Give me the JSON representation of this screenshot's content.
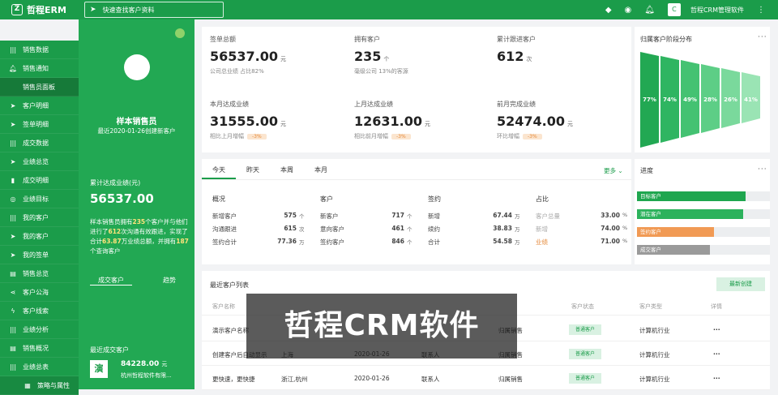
{
  "app": {
    "title": "哲程ERM",
    "logo_mark": "Z"
  },
  "search": {
    "placeholder": "快速查找客户资料"
  },
  "topbar": {
    "company": "哲程CRM管理软件",
    "avatar": "C"
  },
  "sidebar": {
    "items": [
      {
        "label": "销售数据",
        "icon": "bar-icon",
        "sub": false
      },
      {
        "label": "销售通知",
        "icon": "bell-icon",
        "sub": false
      },
      {
        "label": "销售员面板",
        "icon": "",
        "sub": true
      },
      {
        "label": "客户明细",
        "icon": "send-icon",
        "sub": false
      },
      {
        "label": "签单明细",
        "icon": "send-icon",
        "sub": false
      },
      {
        "label": "成交数据",
        "icon": "bar-icon",
        "sub": false
      },
      {
        "label": "业绩总览",
        "icon": "send-icon",
        "sub": false
      },
      {
        "label": "成交明细",
        "icon": "signal-icon",
        "sub": false
      },
      {
        "label": "业绩目标",
        "icon": "target-icon",
        "sub": false
      },
      {
        "label": "我的客户",
        "icon": "bar-icon",
        "sub": false
      },
      {
        "label": "我的客户",
        "icon": "send-icon",
        "sub": false
      },
      {
        "label": "我的签单",
        "icon": "send-icon",
        "sub": false
      },
      {
        "label": "销售总览",
        "icon": "doc-icon",
        "sub": false
      },
      {
        "label": "客户公海",
        "icon": "share-icon",
        "sub": false
      },
      {
        "label": "客户线索",
        "icon": "bolt-icon",
        "sub": false
      },
      {
        "label": "业绩分析",
        "icon": "bar-icon",
        "sub": false
      },
      {
        "label": "销售概况",
        "icon": "doc-icon",
        "sub": false
      },
      {
        "label": "业绩总表",
        "icon": "bar-icon",
        "sub": false
      },
      {
        "label": "策略与属性",
        "icon": "grid-icon",
        "sub": true
      }
    ]
  },
  "profile": {
    "name": "样本销售员",
    "date": "最近2020-01-26创建新客户",
    "total_label": "累计达成业绩(元)",
    "total_value": "56537.00",
    "desc_prefix": "样本销售员拥有",
    "desc_customers": "235",
    "desc_mid1": "个客户并与他们进行了",
    "desc_visits": "612",
    "desc_mid2": "次沟通有效跟进，实现了合计",
    "desc_amount": "63.87",
    "desc_mid3": "万业绩总额，并拥有",
    "desc_repeat": "187",
    "desc_suffix": "个查询客户",
    "tabs": [
      "成交客户",
      "趋势"
    ],
    "recent_label": "最近成交客户",
    "recent_icon": "演",
    "recent_amount": "84228.00",
    "recent_unit": "元",
    "recent_name": "杭州哲程软件有限..."
  },
  "stats": [
    {
      "title": "签单总额",
      "value": "56537.00",
      "unit": "元",
      "sub": "公司总业绩  占比82%",
      "badge": ""
    },
    {
      "title": "拥有客户",
      "value": "235",
      "unit": "个",
      "sub": "毫级公司  13%的客源",
      "badge": ""
    },
    {
      "title": "累计跟进客户",
      "value": "612",
      "unit": "次",
      "sub": "",
      "badge": ""
    },
    {
      "title": "本月达成业绩",
      "value": "31555.00",
      "unit": "元",
      "sub": "相比上月增幅",
      "badge": "-3%"
    },
    {
      "title": "上月达成业绩",
      "value": "12631.00",
      "unit": "元",
      "sub": "相比前月增幅",
      "badge": "-3%"
    },
    {
      "title": "前月完成业绩",
      "value": "52474.00",
      "unit": "元",
      "sub": "环比增幅",
      "badge": "-3%"
    }
  ],
  "funnel": {
    "title": "归属客户阶段分布",
    "more": "···",
    "values": [
      77,
      74,
      49,
      28,
      26,
      41
    ],
    "labels": [
      "77%",
      "74%",
      "49%",
      "28%",
      "26%",
      "41%"
    ],
    "colors": [
      "#22a853",
      "#2fb561",
      "#44c272",
      "#5dce86",
      "#7ad99c",
      "#9ae4b4"
    ]
  },
  "period_tabs": [
    "今天",
    "昨天",
    "本周",
    "本月"
  ],
  "period_more": "更多 ⌄",
  "overview": {
    "columns": [
      {
        "header": "概况",
        "rows": [
          [
            "新增客户",
            "575",
            "个"
          ],
          [
            "沟通跟进",
            "615",
            "次"
          ],
          [
            "签约合计",
            "77.36",
            "万"
          ]
        ]
      },
      {
        "header": "客户",
        "rows": [
          [
            "新客户",
            "717",
            "个"
          ],
          [
            "意向客户",
            "461",
            "个"
          ],
          [
            "签约客户",
            "846",
            "个"
          ]
        ]
      },
      {
        "header": "签约",
        "rows": [
          [
            "新增",
            "67.44",
            "万"
          ],
          [
            "续约",
            "38.83",
            "万"
          ],
          [
            "合计",
            "54.58",
            "万"
          ]
        ]
      },
      {
        "header": "占比",
        "rows": [
          [
            "客户总量",
            "33.00",
            "%"
          ],
          [
            "新增",
            "74.00",
            "%"
          ],
          [
            "业绩",
            "71.00",
            "%"
          ]
        ]
      }
    ]
  },
  "progress": {
    "title": "进度",
    "more": "···",
    "bars": [
      {
        "label": "目标客户",
        "value": 0.82,
        "color": "#1fa64f"
      },
      {
        "label": "潜在客户",
        "value": 0.8,
        "color": "#2cb25c"
      },
      {
        "label": "签约客户",
        "value": 0.58,
        "color": "#f19a54"
      },
      {
        "label": "成交客户",
        "value": 0.55,
        "color": "#9a9a9a"
      }
    ]
  },
  "customer_list": {
    "title": "最近客户列表",
    "new_button": "最新创建",
    "headers": [
      "客户名称",
      "",
      "",
      "",
      "客户状态",
      "客户类型",
      "详情"
    ],
    "rows": [
      {
        "name": "演示客户名称",
        "city": "",
        "date": "",
        "contact": "",
        "owner": "归属销售",
        "status": "普通客户",
        "type": "计算机行业",
        "detail": "···"
      },
      {
        "name": "创建客户后自动显示",
        "city": "上海",
        "date": "2020-01-26",
        "contact": "联系人",
        "owner": "归属销售",
        "status": "普通客户",
        "type": "计算机行业",
        "detail": "···"
      },
      {
        "name": "更快速，更快捷",
        "city": "浙江,杭州",
        "date": "2020-01-26",
        "contact": "联系人",
        "owner": "归属销售",
        "status": "普通客户",
        "type": "计算机行业",
        "detail": "···"
      }
    ]
  },
  "watermark": {
    "text": "哲程CRM软件"
  }
}
